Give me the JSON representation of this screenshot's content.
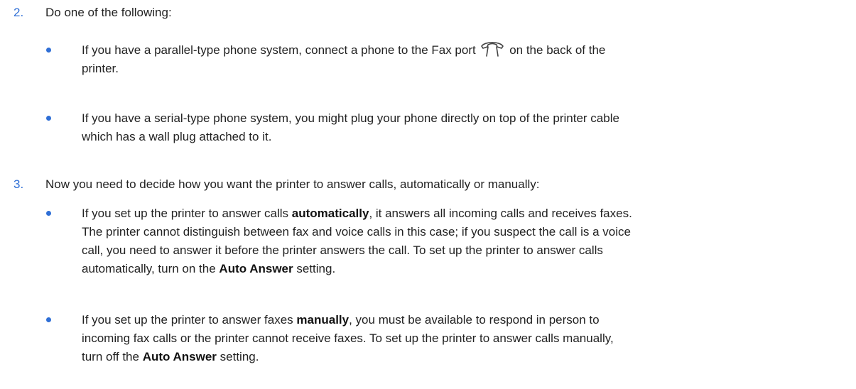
{
  "step2": {
    "number": "2.",
    "text": "Do one of the following:",
    "bullets": [
      {
        "before": "If you have a parallel-type phone system, connect a phone to the Fax port",
        "after": "on the back of the",
        "cont": "printer.",
        "icon": "fax-port-icon"
      },
      {
        "line1": "If you have a serial-type phone system, you might plug your phone directly on top of the printer cable",
        "line2": "which has a wall plug attached to it."
      }
    ]
  },
  "step3": {
    "number": "3.",
    "text": "Now you need to decide how you want the printer to answer calls, automatically or manually:",
    "bullets": [
      {
        "l1_before": "If you set up the printer to answer calls",
        "l1_bold": "automatically",
        "l1_after": ", it answers all incoming calls and receives faxes.",
        "line2": "The printer cannot distinguish between fax and voice calls in this case; if you suspect the call is a voice",
        "line3": "call, you need to answer it before the printer answers the call. To set up the printer to answer calls",
        "l4_before": "automatically, turn on the",
        "l4_bold": "Auto Answer",
        "l4_after": "setting."
      },
      {
        "l1_before": "If you set up the printer to answer faxes",
        "l1_bold": "manually",
        "l1_after": ", you must be available to respond in person to",
        "line2": "incoming fax calls or the printer cannot receive faxes. To set up the printer to answer calls manually,",
        "l3_before": "turn off the",
        "l3_bold": "Auto Answer",
        "l3_after": "setting."
      }
    ]
  }
}
